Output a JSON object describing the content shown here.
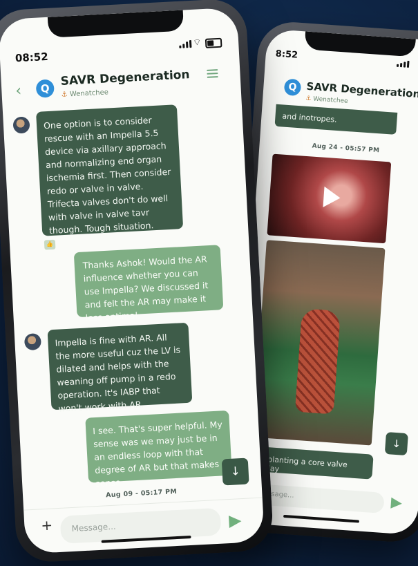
{
  "back_phone": {
    "time": "8:52",
    "title": "SAVR Degeneration",
    "location": "Wenatchee",
    "partial_message": "and inotropes.",
    "timestamp": "Aug 24 - 05:57 PM",
    "last_message": "Explanting a core valve today",
    "input_placeholder": "Message..."
  },
  "front_phone": {
    "time": "08:52",
    "title": "SAVR Degeneration",
    "location": "Wenatchee",
    "messages": [
      {
        "side": "in",
        "text": "One option is to consider rescue with an Impella 5.5 device via axillary approach and normalizing end organ ischemia first. Then consider redo or valve in valve. Trifecta valves don't do well with valve in valve tavr though. Tough situation."
      },
      {
        "side": "out",
        "text": "Thanks Ashok! Would the AR influence whether you can use Impella? We discussed it and felt the AR may make it less optimal."
      },
      {
        "side": "in",
        "text": "Impella is fine with AR. All the more useful cuz the LV is dilated and helps with the weaning off pump in a redo operation. It's IABP that won't work with AR."
      },
      {
        "side": "out",
        "text": "I see. That's super helpful. My sense was we may just be in an endless loop with that degree of AR but that makes sense"
      }
    ],
    "timestamp": "Aug 09 - 05:17 PM",
    "input_placeholder": "Message..."
  },
  "colors": {
    "incoming_bubble": "#3e5c49",
    "outgoing_bubble": "#7fae84",
    "accent": "#71b07d",
    "background": "#0f2646"
  },
  "icons": {
    "back": "chevron-left-icon",
    "menu": "hamburger-icon",
    "send": "send-icon",
    "add": "plus-icon",
    "download": "download-icon",
    "location": "anchor-icon",
    "play": "play-icon"
  }
}
